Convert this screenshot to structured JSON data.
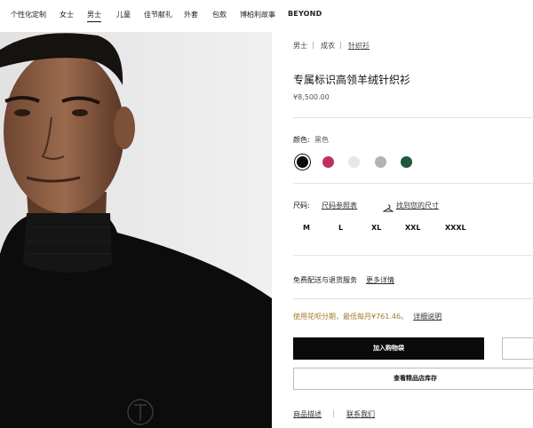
{
  "nav": {
    "items": [
      {
        "label": "个性化定制"
      },
      {
        "label": "女士"
      },
      {
        "label": "男士"
      },
      {
        "label": "儿童"
      },
      {
        "label": "佳节献礼"
      },
      {
        "label": "外套"
      },
      {
        "label": "包款"
      },
      {
        "label": "博柏利故事"
      },
      {
        "label": "BEYOND"
      }
    ],
    "active": "男士"
  },
  "breadcrumb": [
    "男士",
    "成衣",
    "针织衫"
  ],
  "breadcrumb_separator": "|",
  "product": {
    "title": "专属标识高领羊绒针织衫",
    "price": "¥8,500.00"
  },
  "color": {
    "label": "颜色:",
    "value": "黑色",
    "swatches": [
      {
        "name": "black",
        "hex": "#0d0d0d",
        "selected": true
      },
      {
        "name": "raspberry",
        "hex": "#c0305f",
        "selected": false
      },
      {
        "name": "white",
        "hex": "#e6e6e6",
        "selected": false
      },
      {
        "name": "grey",
        "hex": "#b3b3b3",
        "selected": false
      },
      {
        "name": "green",
        "hex": "#1d5a3a",
        "selected": false
      }
    ]
  },
  "size": {
    "label": "尺码:",
    "chart_link": "尺码参照表",
    "find_link": "找到您的尺寸",
    "options": [
      "M",
      "L",
      "XL",
      "XXL",
      "XXXL"
    ]
  },
  "shipping": {
    "text": "免费配送与退货服务",
    "more": "更多详情"
  },
  "installment": {
    "text": "使用花呗分期，最低每月¥761.46。",
    "detail": "详细说明"
  },
  "buttons": {
    "add_to_bag": "加入购物袋",
    "check_store": "查看精品店库存"
  },
  "footer_links": [
    "商品描述",
    "联系我们"
  ]
}
